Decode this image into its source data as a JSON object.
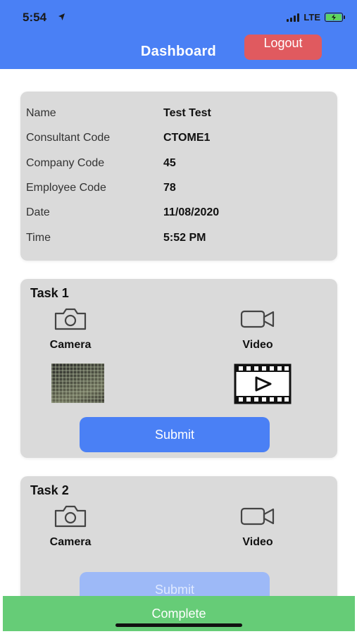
{
  "status_bar": {
    "time": "5:54",
    "network": "LTE"
  },
  "header": {
    "title": "Dashboard",
    "logout_label": "Logout",
    "background": "#4a80f5",
    "logout_color": "#e05a5f"
  },
  "info": {
    "rows": [
      {
        "label": "Name",
        "value": "Test Test"
      },
      {
        "label": "Consultant Code",
        "value": "CTOME1"
      },
      {
        "label": "Company Code",
        "value": "45"
      },
      {
        "label": "Employee Code",
        "value": "78"
      },
      {
        "label": "Date",
        "value": "11/08/2020"
      },
      {
        "label": "Time",
        "value": "5:52 PM"
      }
    ]
  },
  "tasks": [
    {
      "title": "Task 1",
      "camera_label": "Camera",
      "video_label": "Video",
      "submit_label": "Submit",
      "icons": [
        "camera-icon",
        "video-camera-icon",
        "photo-thumbnail",
        "video-file-icon"
      ]
    },
    {
      "title": "Task 2",
      "camera_label": "Camera",
      "video_label": "Video",
      "submit_label": "Submit",
      "icons": [
        "camera-icon",
        "video-camera-icon"
      ]
    }
  ],
  "footer": {
    "complete_label": "Complete",
    "color": "#66cc77"
  }
}
